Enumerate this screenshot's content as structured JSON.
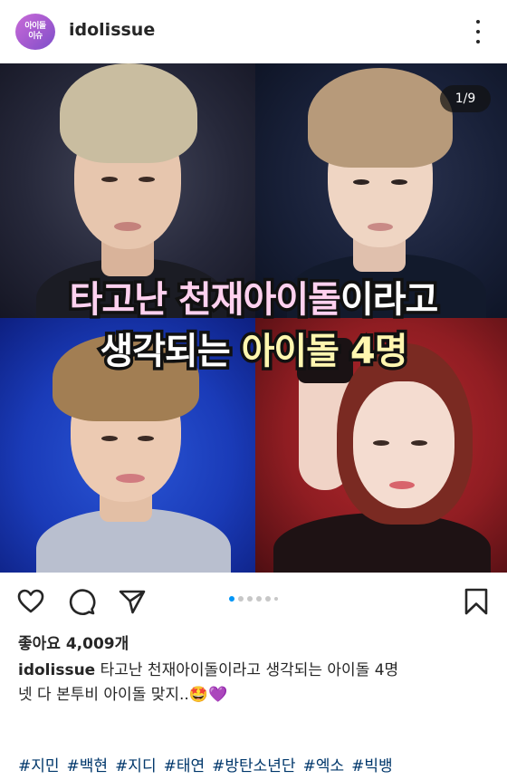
{
  "header": {
    "avatar_line1": "아이돌",
    "avatar_line2": "이슈",
    "username": "idolissue",
    "more_icon": "more-vertical-icon"
  },
  "post": {
    "counter": "1/9",
    "headline_part1": "타고난 천재아이돌",
    "headline_part2": "이라고",
    "headline_part3": "생각되는 ",
    "headline_part4": "아이돌 4명",
    "colors": {
      "highlight_pink": "#ffd1ef",
      "highlight_yellow": "#fff7b0",
      "bg_top_left": "#26283a",
      "bg_top_right": "#182038",
      "bg_bottom_left": "#1a3bb8",
      "bg_bottom_right": "#8f1d22"
    }
  },
  "actions": {
    "icons": [
      "heart-icon",
      "comment-icon",
      "share-icon",
      "bookmark-icon"
    ],
    "carousel": {
      "total_dots": 6,
      "active_index": 0,
      "active_color": "#0095f6"
    }
  },
  "likes": "좋아요 4,009개",
  "caption": {
    "username": "idolissue",
    "line1": "타고난 천재아이돌이라고 생각되는 아이돌 4명",
    "line2": "넷 다 본투비 아이돌 맞지..🤩💜"
  },
  "hashtags": [
    "#지민",
    "#백현",
    "#지디",
    "#태연",
    "#방탄소년단",
    "#엑소",
    "#빅뱅"
  ],
  "link_color": "#00376b"
}
